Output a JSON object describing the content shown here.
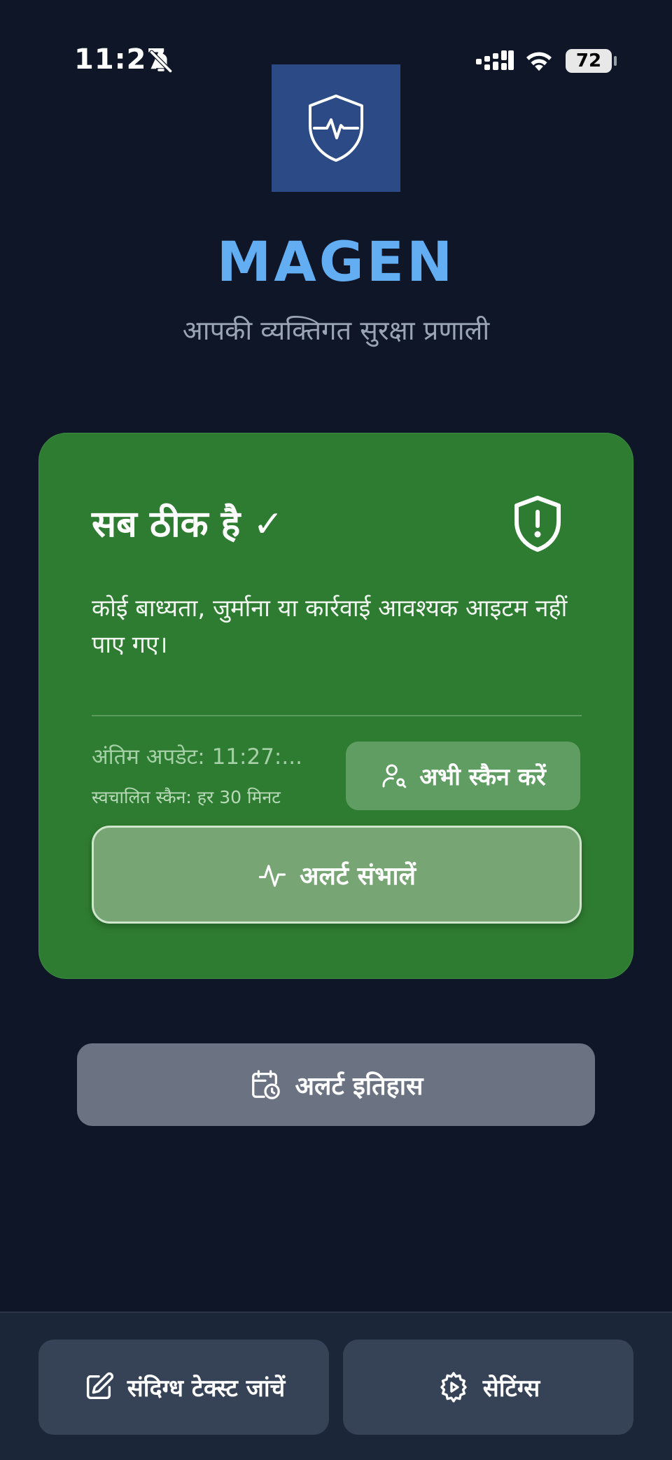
{
  "status_bar": {
    "time": "11:27",
    "battery": "72",
    "icons": [
      "bell-slash-icon",
      "signal-icon",
      "wifi-icon",
      "battery-icon"
    ]
  },
  "header": {
    "logo_icon": "shield-pulse-icon",
    "title": "MAGEN",
    "subtitle": "आपकी व्यक्तिगत सुरक्षा प्रणाली"
  },
  "status_card": {
    "heading": "सब ठीक है ✓",
    "description": "कोई बाध्यता, जुर्माना या कार्रवाई आवश्यक आइटम नहीं पाए गए।",
    "last_update": "अंतिम अपडेट: 11:27:...",
    "auto_scan": "स्वचालित स्कैन: हर 30 मिनट",
    "scan_button_label": "अभी स्कैन करें",
    "alert_button_label": "अलर्ट संभालें",
    "color": "#2e7c31"
  },
  "history_button_label": "अलर्ट इतिहास",
  "bottom_bar": {
    "check_text_label": "संदिग्ध टेक्स्ट जांचें",
    "settings_label": "सेटिंग्स"
  },
  "colors": {
    "background": "#0e1628",
    "accent": "#63aef3",
    "card_green": "#2e7c31"
  }
}
